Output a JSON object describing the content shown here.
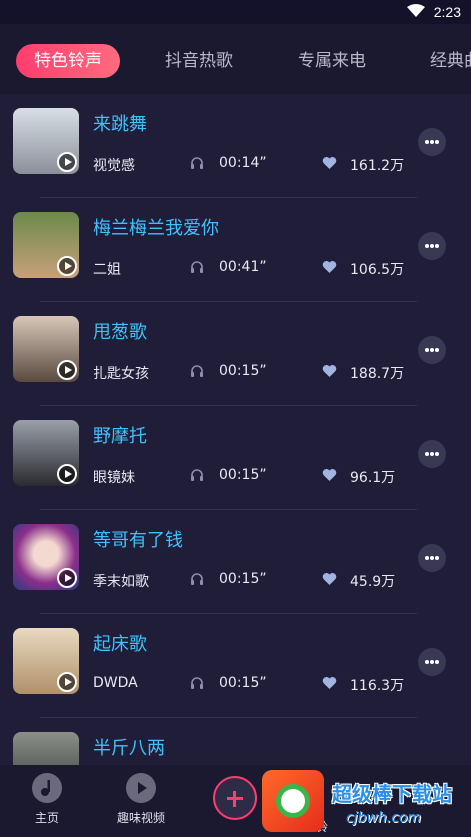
{
  "status": {
    "time": "2:23"
  },
  "tabs": [
    {
      "label": "特色铃声"
    },
    {
      "label": "抖音热歌"
    },
    {
      "label": "专属来电"
    },
    {
      "label": "经典曲"
    }
  ],
  "songs": [
    {
      "title": "来跳舞",
      "artist": "视觉感",
      "duration": "00:14”",
      "likes": "161.2万"
    },
    {
      "title": "梅兰梅兰我爱你",
      "artist": "二姐",
      "duration": "00:41”",
      "likes": "106.5万"
    },
    {
      "title": "甩葱歌",
      "artist": "扎匙女孩",
      "duration": "00:15”",
      "likes": "188.7万"
    },
    {
      "title": "野摩托",
      "artist": "眼镜妹",
      "duration": "00:15”",
      "likes": "96.1万"
    },
    {
      "title": "等哥有了钱",
      "artist": "季末如歌",
      "duration": "00:15”",
      "likes": "45.9万"
    },
    {
      "title": "起床歌",
      "artist": "DWDA",
      "duration": "00:15”",
      "likes": "116.3万"
    },
    {
      "title": "半斤八两",
      "artist": "",
      "duration": "",
      "likes": ""
    }
  ],
  "bottom_nav": {
    "home": "主页",
    "fun_video": "趣味视频",
    "partial": "铃"
  },
  "watermark": {
    "name": "超级棒下载站",
    "url": "cjbwh.com"
  },
  "colors": {
    "accent": "#ff3d6e",
    "title": "#3ec2ff",
    "background": "#1f1d38"
  }
}
